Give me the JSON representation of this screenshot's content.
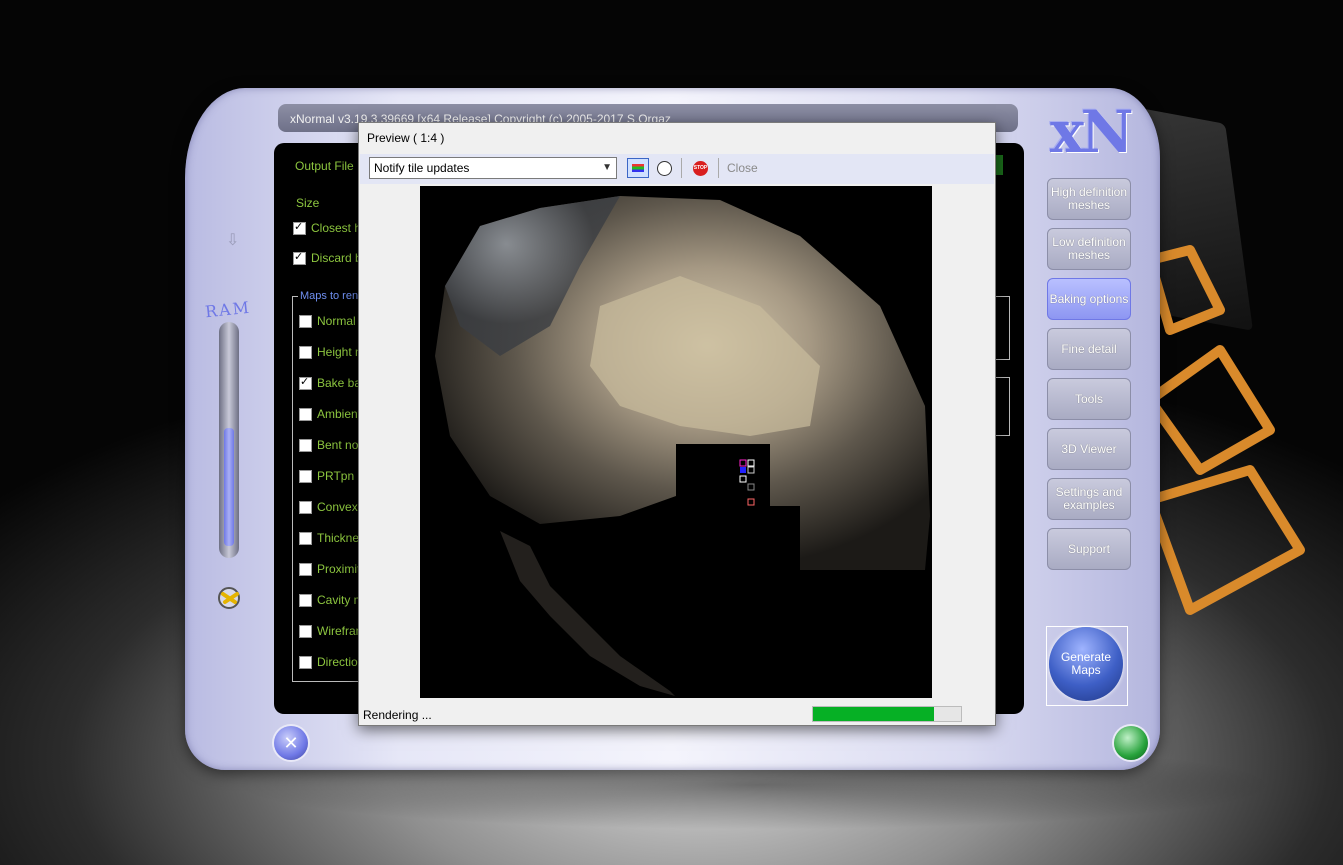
{
  "window": {
    "title": "xNormal v3.19.3.39669 [x64 Release] Copyright (c) 2005-2017 S.Orgaz",
    "logo": "xN"
  },
  "panel": {
    "output_file_label": "Output File",
    "size_label": "Size",
    "options": [
      {
        "label": "Closest hit",
        "checked": true
      },
      {
        "label": "Discard ba",
        "checked": true
      }
    ],
    "maps_group_label": "Maps to rend",
    "maps": [
      {
        "label": "Normal m",
        "checked": false
      },
      {
        "label": "Height m",
        "checked": false
      },
      {
        "label": "Bake bas",
        "checked": true
      },
      {
        "label": "Ambient",
        "checked": false
      },
      {
        "label": "Bent nor",
        "checked": false
      },
      {
        "label": "PRTpn",
        "checked": false
      },
      {
        "label": "Convexit",
        "checked": false
      },
      {
        "label": "Thicknes",
        "checked": false
      },
      {
        "label": "Proximity",
        "checked": false
      },
      {
        "label": "Cavity ma",
        "checked": false
      },
      {
        "label": "Wirefram",
        "checked": false
      },
      {
        "label": "Direction",
        "checked": false
      }
    ]
  },
  "ram": {
    "label": "RAM",
    "fill_fraction": 0.52
  },
  "nav": {
    "items": [
      {
        "label": "High definition meshes",
        "active": false
      },
      {
        "label": "Low definition meshes",
        "active": false
      },
      {
        "label": "Baking options",
        "active": true
      },
      {
        "label": "Fine detail",
        "active": false
      },
      {
        "label": "Tools",
        "active": false
      },
      {
        "label": "3D Viewer",
        "active": false
      },
      {
        "label": "Settings and examples",
        "active": false
      },
      {
        "label": "Support",
        "active": false
      }
    ],
    "generate_label": "Generate Maps"
  },
  "preview": {
    "title": "Preview ( 1:4 )",
    "mode_select": "Notify tile updates",
    "close_label": "Close",
    "stop_icon_text": "STOP",
    "status": "Rendering ...",
    "progress": 0.82
  },
  "colors": {
    "accent": "#6f78e6",
    "label_green": "#8dc63f",
    "progress_green": "#06b025"
  }
}
